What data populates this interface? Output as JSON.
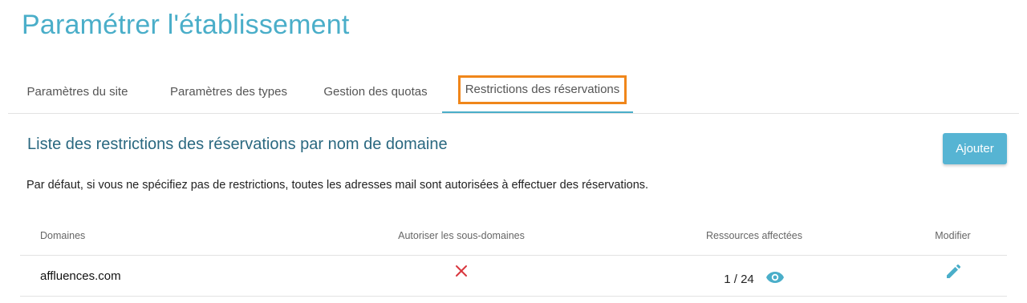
{
  "page": {
    "title": "Paramétrer l'établissement"
  },
  "tabs": [
    {
      "label": "Paramètres du site"
    },
    {
      "label": "Paramètres des types"
    },
    {
      "label": "Gestion des quotas"
    },
    {
      "label": "Restrictions des réservations"
    }
  ],
  "section": {
    "title": "Liste des restrictions des réservations par nom de domaine",
    "add_label": "Ajouter",
    "description": "Par défaut, si vous ne spécifiez pas de restrictions, toutes les adresses mail sont autorisées à effectuer des réservations."
  },
  "table": {
    "headers": [
      "Domaines",
      "Autoriser les sous-domaines",
      "Ressources affectées",
      "Modifier"
    ],
    "rows": [
      {
        "domain": "affluences.com",
        "subdomains_icon": "close-icon",
        "resources": "1 / 24",
        "view_icon": "eye-icon",
        "edit_icon": "pencil-icon"
      }
    ]
  },
  "colors": {
    "accent": "#4aaec9",
    "highlight": "#f0861a",
    "danger": "#d9363e",
    "button": "#56b4d3"
  }
}
